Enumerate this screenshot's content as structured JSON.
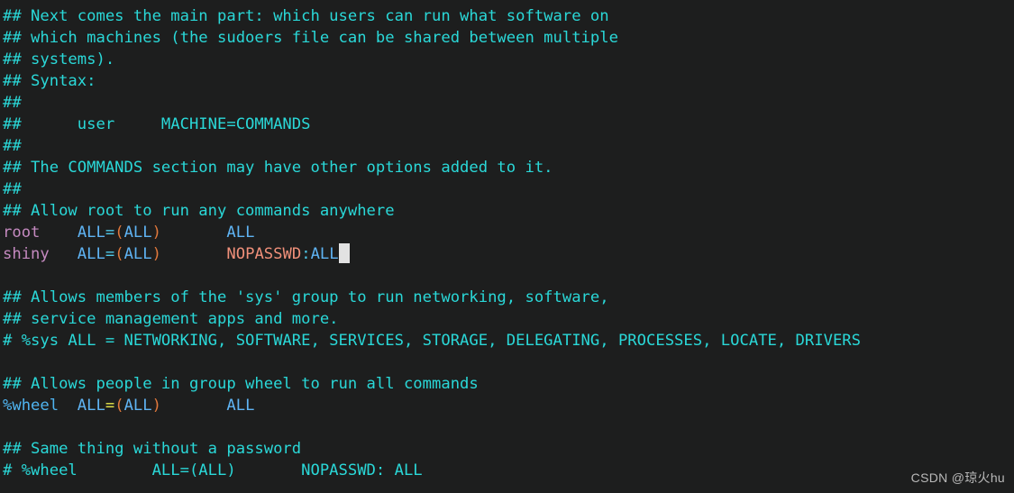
{
  "window": {
    "kind": "terminal-text-editor",
    "background_color": "#1d1e1e",
    "file_context": "sudoers"
  },
  "colors": {
    "background": "#1d1e1e",
    "comment_cyan": "#2ad8d8",
    "username_pink": "#c58ac0",
    "keyword_blue": "#5fb4f4",
    "equals_cyan": "#4fc8e8",
    "equals_yellow": "#e8e84a",
    "paren_orange": "#e0783c",
    "nopasswd_salmon": "#f0907a",
    "group_blue": "#4fb4f0",
    "cursor": "#e2e2e2",
    "watermark": "#b9b9b9"
  },
  "cursor": {
    "visible": true,
    "line": 11,
    "column": 36,
    "glyph": "block-cursor"
  },
  "watermark": {
    "text": "CSDN @琼火hu"
  },
  "lines": [
    {
      "id": 1,
      "tokens": [
        {
          "text": "## Next comes the main part: which users can run what software on",
          "color": "comment"
        }
      ]
    },
    {
      "id": 2,
      "tokens": [
        {
          "text": "## which machines (the sudoers file can be shared between multiple",
          "color": "comment"
        }
      ]
    },
    {
      "id": 3,
      "tokens": [
        {
          "text": "## systems).",
          "color": "comment"
        }
      ]
    },
    {
      "id": 4,
      "tokens": [
        {
          "text": "## Syntax:",
          "color": "comment"
        }
      ]
    },
    {
      "id": 5,
      "tokens": [
        {
          "text": "##",
          "color": "comment"
        }
      ]
    },
    {
      "id": 6,
      "tokens": [
        {
          "text": "##      user     MACHINE=COMMANDS",
          "color": "comment"
        }
      ]
    },
    {
      "id": 7,
      "tokens": [
        {
          "text": "##",
          "color": "comment"
        }
      ]
    },
    {
      "id": 8,
      "tokens": [
        {
          "text": "## The COMMANDS section may have other options added to it.",
          "color": "comment"
        }
      ]
    },
    {
      "id": 9,
      "tokens": [
        {
          "text": "##",
          "color": "comment"
        }
      ]
    },
    {
      "id": 10,
      "tokens": [
        {
          "text": "## Allow root to run any commands anywhere",
          "color": "comment"
        }
      ]
    },
    {
      "id": 11,
      "tokens": [
        {
          "text": "root",
          "color": "user"
        },
        {
          "text": "    ",
          "color": "plain"
        },
        {
          "text": "ALL",
          "color": "all"
        },
        {
          "text": "=",
          "color": "eq-cyan"
        },
        {
          "text": "(",
          "color": "paren"
        },
        {
          "text": "ALL",
          "color": "all"
        },
        {
          "text": ")",
          "color": "paren"
        },
        {
          "text": "       ",
          "color": "plain"
        },
        {
          "text": "ALL",
          "color": "all"
        }
      ]
    },
    {
      "id": 12,
      "tokens": [
        {
          "text": "shiny",
          "color": "user"
        },
        {
          "text": "   ",
          "color": "plain"
        },
        {
          "text": "ALL",
          "color": "all"
        },
        {
          "text": "=",
          "color": "eq-cyan"
        },
        {
          "text": "(",
          "color": "paren"
        },
        {
          "text": "ALL",
          "color": "all"
        },
        {
          "text": ")",
          "color": "paren"
        },
        {
          "text": "       ",
          "color": "plain"
        },
        {
          "text": "NOPASSWD",
          "color": "nopasswd"
        },
        {
          "text": ":",
          "color": "colon"
        },
        {
          "text": "ALL",
          "color": "all"
        },
        {
          "text": "",
          "color": "cursor"
        }
      ]
    },
    {
      "id": 13,
      "tokens": [
        {
          "text": "",
          "color": "plain"
        }
      ]
    },
    {
      "id": 14,
      "tokens": [
        {
          "text": "## Allows members of the 'sys' group to run networking, software,",
          "color": "comment"
        }
      ]
    },
    {
      "id": 15,
      "tokens": [
        {
          "text": "## service management apps and more.",
          "color": "comment"
        }
      ]
    },
    {
      "id": 16,
      "tokens": [
        {
          "text": "# %sys ALL = NETWORKING, SOFTWARE, SERVICES, STORAGE, DELEGATING, PROCESSES, LOCATE, DRIVERS",
          "color": "comment"
        }
      ]
    },
    {
      "id": 17,
      "tokens": [
        {
          "text": "",
          "color": "plain"
        }
      ]
    },
    {
      "id": 18,
      "tokens": [
        {
          "text": "## Allows people in group wheel to run all commands",
          "color": "comment"
        }
      ]
    },
    {
      "id": 19,
      "tokens": [
        {
          "text": "%wheel",
          "color": "group"
        },
        {
          "text": "  ",
          "color": "plain"
        },
        {
          "text": "ALL",
          "color": "all"
        },
        {
          "text": "=",
          "color": "eq-yellow"
        },
        {
          "text": "(",
          "color": "paren"
        },
        {
          "text": "ALL",
          "color": "all"
        },
        {
          "text": ")",
          "color": "paren"
        },
        {
          "text": "       ",
          "color": "plain"
        },
        {
          "text": "ALL",
          "color": "all"
        }
      ]
    },
    {
      "id": 20,
      "tokens": [
        {
          "text": "",
          "color": "plain"
        }
      ]
    },
    {
      "id": 21,
      "tokens": [
        {
          "text": "## Same thing without a password",
          "color": "comment"
        }
      ]
    },
    {
      "id": 22,
      "tokens": [
        {
          "text": "# %wheel        ALL=(ALL)       NOPASSWD: ALL",
          "color": "comment"
        }
      ]
    }
  ]
}
